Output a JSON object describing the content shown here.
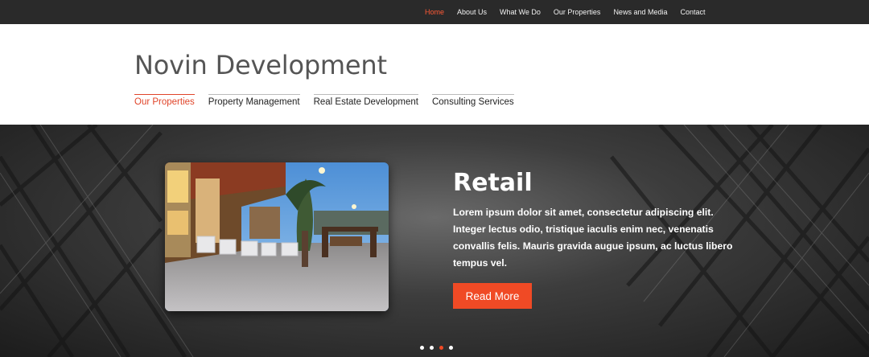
{
  "topnav": {
    "items": [
      {
        "label": "Home",
        "active": true
      },
      {
        "label": "About Us",
        "active": false
      },
      {
        "label": "What We Do",
        "active": false
      },
      {
        "label": "Our Properties",
        "active": false
      },
      {
        "label": "News and Media",
        "active": false
      },
      {
        "label": "Contact",
        "active": false
      }
    ]
  },
  "header": {
    "brand": "Novin Development",
    "subnav": [
      {
        "label": "Our Properties",
        "active": true
      },
      {
        "label": "Property Management",
        "active": false
      },
      {
        "label": "Real Estate Development",
        "active": false
      },
      {
        "label": "Consulting Services",
        "active": false
      }
    ]
  },
  "slider": {
    "title": "Retail",
    "text": "Lorem ipsum dolor sit amet, consectetur adipiscing elit. Integer lectus odio, tristique iaculis enim nec, venenatis convallis felis. Mauris gravida augue ipsum, ac luctus libero tempus vel.",
    "button_label": "Read More",
    "dots_count": 4,
    "active_dot": 3
  },
  "colors": {
    "accent": "#f04a25",
    "topbar": "#2a2a2a"
  }
}
